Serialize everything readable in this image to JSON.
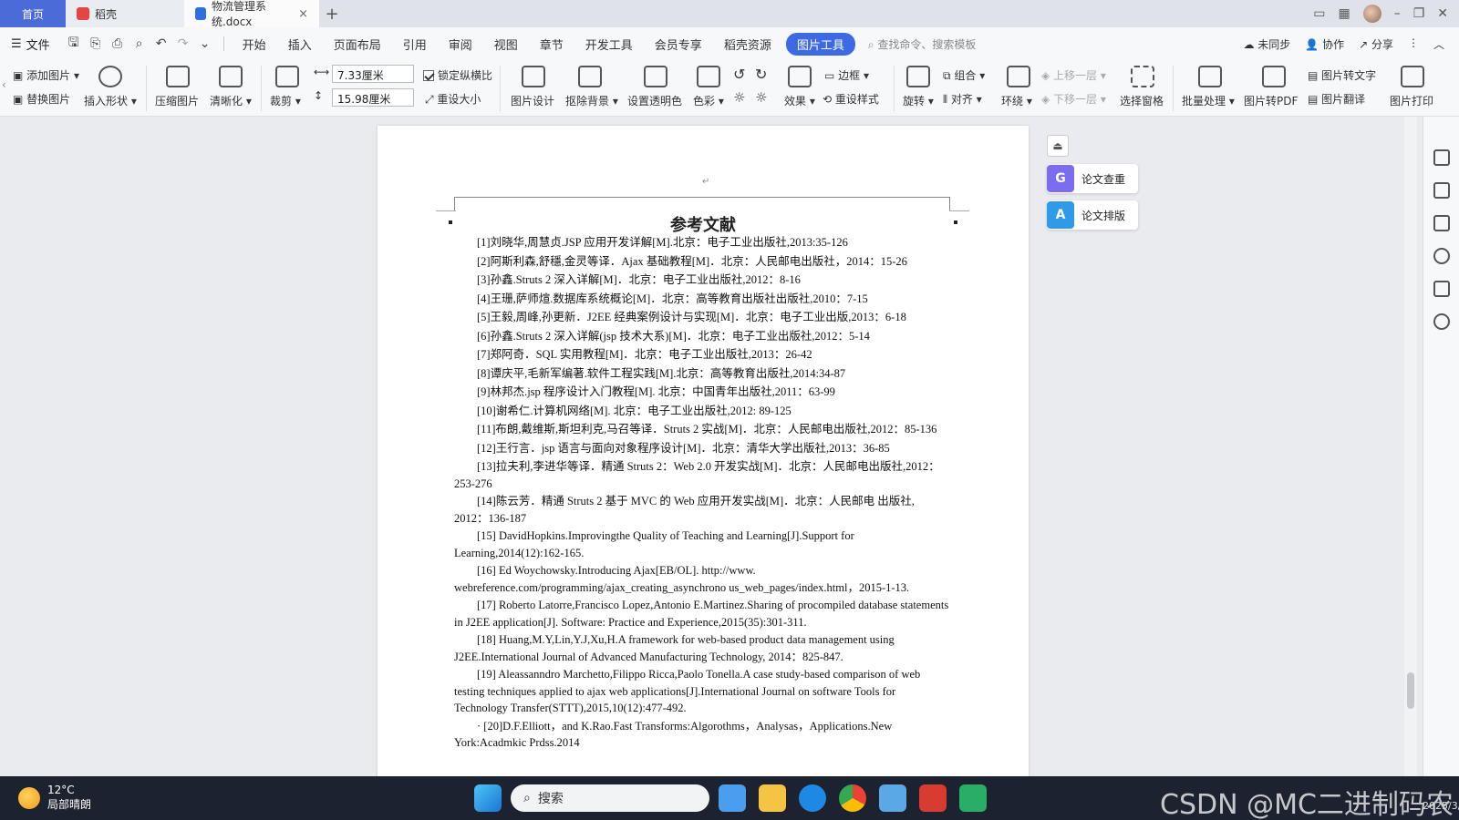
{
  "tabs": {
    "home": "首页",
    "daoke": "稻壳",
    "doc": "物流管理系统.docx",
    "add": "+"
  },
  "menu": {
    "file": "文件",
    "items": [
      "开始",
      "插入",
      "页面布局",
      "引用",
      "审阅",
      "视图",
      "章节",
      "开发工具",
      "会员专享",
      "稻壳资源"
    ],
    "active": "图片工具",
    "search": "查找命令、搜索模板",
    "unsynced": "未同步",
    "collab": "协作",
    "share": "分享"
  },
  "ribbon": {
    "add_image": "添加图片",
    "replace_image": "替换图片",
    "insert_shape": "插入形状",
    "compress": "压缩图片",
    "sharpen": "清晰化",
    "crop": "裁剪",
    "width": "7.33厘米",
    "height": "15.98厘米",
    "lock_ratio": "锁定纵横比",
    "reset_size": "重设大小",
    "design": "图片设计",
    "remove_bg": "抠除背景",
    "transparent": "设置透明色",
    "color": "色彩",
    "effect": "效果",
    "border": "边框",
    "reset_style": "重设样式",
    "rotate": "旋转",
    "group": "组合",
    "align": "对齐",
    "wrap": "环绕",
    "bring_forward": "上移一层",
    "send_backward": "下移一层",
    "select_pane": "选择窗格",
    "batch": "批量处理",
    "to_pdf": "图片转PDF",
    "to_text": "图片转文字",
    "translate": "图片翻译",
    "print": "图片打印"
  },
  "document": {
    "title": "参考文献",
    "references": [
      "[1]刘晓华,周慧贞.JSP 应用开发详解[M].北京：电子工业出版社,2013:35-126",
      "[2]阿斯利森,舒穩,金灵等译．Ajax 基础教程[M]．北京：人民邮电出版社，2014：15-26",
      "[3]孙鑫.Struts 2 深入详解[M]．北京：电子工业出版社,2012：8-16",
      "[4]王珊,萨师煊.数据库系统概论[M]．北京：高等教育出版社出版社,2010：7-15",
      "[5]王毅,周峰,孙更新．J2EE 经典案例设计与实现[M]．北京：电子工业出版,2013：6-18",
      "[6]孙鑫.Struts 2 深入详解(jsp 技术大系)[M]．北京：电子工业出版社,2012：5-14",
      "[7]郑阿奇．SQL 实用教程[M]．北京：电子工业出版社,2013：26-42",
      "[8]谭庆平,毛新军编著.软件工程实践[M].北京：高等教育出版社,2014:34-87",
      "[9]林邦杰.jsp 程序设计入门教程[M]. 北京：中国青年出版社,2011：63-99",
      "[10]谢希仁.计算机网络[M]. 北京：电子工业出版社,2012: 89-125",
      "[11]布朗,戴维斯,斯坦利克,马召等译．Struts 2 实战[M]．北京：人民邮电出版社,2012：85-136",
      "[12]王行言．jsp 语言与面向对象程序设计[M]．北京：清华大学出版社,2013：36-85",
      "[13]拉夫利,李进华等译．精通 Struts 2：Web 2.0 开发实战[M]．北京：人民邮电出版社,2012：253-276",
      "[14]陈云芳．精通 Struts 2 基于 MVC 的 Web 应用开发实战[M]．北京：人民邮电 出版社, 2012：136-187",
      "[15] DavidHopkins.Improvingthe Quality of Teaching and Learning[J].Support for Learning,2014(12):162-165.",
      "[16] Ed Woychowsky.Introducing Ajax[EB/OL]. http://www. webreference.com/programming/ajax_creating_asynchrono us_web_pages/index.html，2015-1-13.",
      "[17] Roberto Latorre,Francisco Lopez,Antonio E.Martinez.Sharing of procompiled database statements in J2EE application[J]. Software: Practice and Experience,2015(35):301-311.",
      "[18] Huang,M.Y,Lin,Y.J,Xu,H.A framework for web-based product data management using J2EE.International Journal of Advanced Manufacturing Technology, 2014：825-847.",
      "[19] Aleassanndro Marchetto,Filippo Ricca,Paolo Tonella.A case study-based comparison of web testing techniques applied to ajax web applications[J].International Journal on software Tools for Technology Transfer(STTT),2015,10(12):477-492.",
      "· [20]D.F.Elliott，and K.Rao.Fast Transforms:Algorothms，Analysas，Applications.New York:Acadmkic Prdss.2014"
    ]
  },
  "side_panel": {
    "check": "论文查重",
    "format": "论文排版"
  },
  "taskbar": {
    "temp": "12°C",
    "weather": "局部晴朗",
    "search": "搜索",
    "watermark": "CSDN @MC二进制码农",
    "date": "2025/3/6"
  },
  "colors": {
    "accent": "#3d6ae3",
    "home_tab": "#4b6bd8",
    "wps_red": "#d83b2f",
    "taskbar": "#1d2230"
  }
}
